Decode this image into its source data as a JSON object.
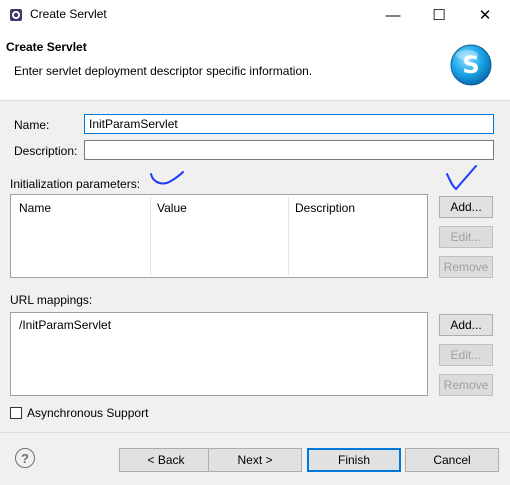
{
  "window": {
    "title": "Create Servlet",
    "controls": {
      "minimize": "—",
      "maximize": "☐",
      "close": "✕"
    }
  },
  "banner": {
    "title": "Create Servlet",
    "description": "Enter servlet deployment descriptor specific information.",
    "logo_letter": "S"
  },
  "form": {
    "name_label": "Name:",
    "name_value": "InitParamServlet",
    "description_label": "Description:",
    "description_value": ""
  },
  "init_params": {
    "label": "Initialization parameters:",
    "columns": [
      "Name",
      "Value",
      "Description"
    ],
    "buttons": {
      "add": "Add...",
      "edit": "Edit...",
      "remove": "Remove"
    }
  },
  "url_mappings": {
    "label": "URL mappings:",
    "items": [
      "/InitParamServlet"
    ],
    "buttons": {
      "add": "Add...",
      "edit": "Edit...",
      "remove": "Remove"
    }
  },
  "async": {
    "label": "Asynchronous Support",
    "checked": false
  },
  "footer": {
    "help_icon": "?",
    "back": "< Back",
    "next": "Next >",
    "finish": "Finish",
    "cancel": "Cancel"
  },
  "colors": {
    "accent": "#0078d7",
    "annotation_ink": "#1e3cff"
  }
}
